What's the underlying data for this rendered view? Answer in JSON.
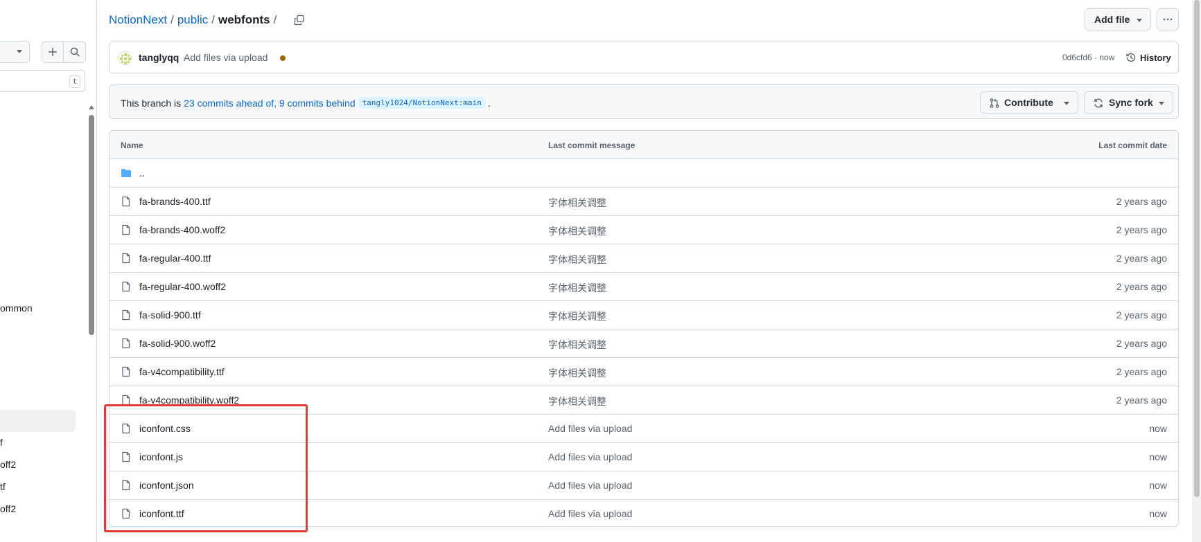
{
  "sidebar": {
    "filter_key": "t",
    "items": [
      {
        "label": "ommon"
      },
      {
        "label": "f"
      },
      {
        "label": "off2"
      },
      {
        "label": "tf"
      },
      {
        "label": "off2"
      }
    ]
  },
  "breadcrumb": {
    "repo": "NotionNext",
    "sep1": "/",
    "folder": "public",
    "sep2": "/",
    "current": "webfonts",
    "sep3": "/"
  },
  "toolbar": {
    "add_file_label": "Add file"
  },
  "latest_commit": {
    "author": "tanglyqq",
    "message": "Add files via upload",
    "sha_time": "0d6cfd6 · now",
    "history_label": "History"
  },
  "branch_status": {
    "prefix": "This branch is",
    "compare_link": "23 commits ahead of, 9 commits behind",
    "upstream_ref": "tangly1024/NotionNext:main",
    "suffix": ".",
    "contribute_label": "Contribute",
    "sync_label": "Sync fork"
  },
  "table": {
    "headers": {
      "name": "Name",
      "message": "Last commit message",
      "date": "Last commit date"
    },
    "parent_dir": "..",
    "rows": [
      {
        "name": "fa-brands-400.ttf",
        "message": "字体相关调整",
        "date": "2 years ago"
      },
      {
        "name": "fa-brands-400.woff2",
        "message": "字体相关调整",
        "date": "2 years ago"
      },
      {
        "name": "fa-regular-400.ttf",
        "message": "字体相关调整",
        "date": "2 years ago"
      },
      {
        "name": "fa-regular-400.woff2",
        "message": "字体相关调整",
        "date": "2 years ago"
      },
      {
        "name": "fa-solid-900.ttf",
        "message": "字体相关调整",
        "date": "2 years ago"
      },
      {
        "name": "fa-solid-900.woff2",
        "message": "字体相关调整",
        "date": "2 years ago"
      },
      {
        "name": "fa-v4compatibility.ttf",
        "message": "字体相关调整",
        "date": "2 years ago"
      },
      {
        "name": "fa-v4compatibility.woff2",
        "message": "字体相关调整",
        "date": "2 years ago"
      },
      {
        "name": "iconfont.css",
        "message": "Add files via upload",
        "date": "now"
      },
      {
        "name": "iconfont.js",
        "message": "Add files via upload",
        "date": "now"
      },
      {
        "name": "iconfont.json",
        "message": "Add files via upload",
        "date": "now"
      },
      {
        "name": "iconfont.ttf",
        "message": "Add files via upload",
        "date": "now"
      }
    ]
  },
  "colors": {
    "link": "#0969da",
    "border": "#d1d9e0",
    "muted": "#59636e",
    "folder": "#54aeff",
    "highlight": "#e53935"
  }
}
